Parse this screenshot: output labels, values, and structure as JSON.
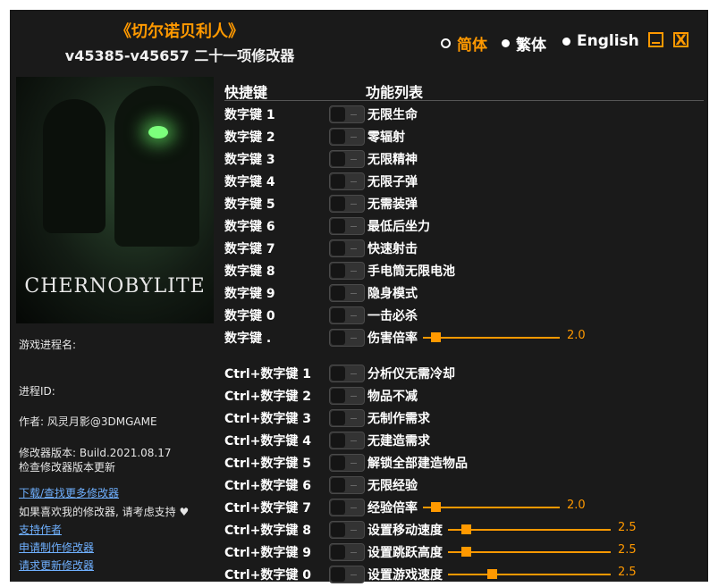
{
  "header": {
    "title": "《切尔诺贝利人》",
    "subtitle": "v45385-v45657 二十一项修改器"
  },
  "languages": [
    {
      "label": "简体",
      "selected": true
    },
    {
      "label": "繁体",
      "selected": false
    },
    {
      "label": "English",
      "selected": false
    }
  ],
  "window": {
    "minimize_icon": "minimize-icon",
    "close_glyph": "X"
  },
  "cover": {
    "logo_text": "CHERNOBYLITE"
  },
  "info": {
    "process_name": "游戏进程名:",
    "process_id": "进程ID:",
    "author": "作者: 风灵月影@3DMGAME",
    "version": "修改器版本: Build.2021.08.17",
    "check_update": "检查修改器版本更新",
    "download_more": "下载/查找更多修改器",
    "support_text": "如果喜欢我的修改器, 请考虑支持 ♥",
    "support_author": "支持作者",
    "request_trainer": "申请制作修改器",
    "request_update": "请求更新修改器"
  },
  "table": {
    "col_hotkey": "快捷键",
    "col_function": "功能列表",
    "rows": [
      {
        "key": "数字键 1",
        "label": "无限生命"
      },
      {
        "key": "数字键 2",
        "label": "零辐射"
      },
      {
        "key": "数字键 3",
        "label": "无限精神"
      },
      {
        "key": "数字键 4",
        "label": "无限子弹"
      },
      {
        "key": "数字键 5",
        "label": "无需装弹"
      },
      {
        "key": "数字键 6",
        "label": "最低后坐力"
      },
      {
        "key": "数字键 7",
        "label": "快速射击"
      },
      {
        "key": "数字键 8",
        "label": "手电筒无限电池"
      },
      {
        "key": "数字键 9",
        "label": "隐身模式"
      },
      {
        "key": "数字键 0",
        "label": "一击必杀"
      },
      {
        "key": "数字键 .",
        "label": "伤害倍率",
        "slider": {
          "value": "2.0",
          "fraction": 0.06
        }
      },
      {
        "key": "Ctrl+数字键 1",
        "label": "分析仪无需冷却"
      },
      {
        "key": "Ctrl+数字键 2",
        "label": "物品不减"
      },
      {
        "key": "Ctrl+数字键 3",
        "label": "无制作需求"
      },
      {
        "key": "Ctrl+数字键 4",
        "label": "无建造需求"
      },
      {
        "key": "Ctrl+数字键 5",
        "label": "解锁全部建造物品"
      },
      {
        "key": "Ctrl+数字键 6",
        "label": "无限经验"
      },
      {
        "key": "Ctrl+数字键 7",
        "label": "经验倍率",
        "slider": {
          "value": "2.0",
          "fraction": 0.06
        }
      },
      {
        "key": "Ctrl+数字键 8",
        "label": "设置移动速度",
        "slider": {
          "value": "2.5",
          "fraction": 0.09
        }
      },
      {
        "key": "Ctrl+数字键 9",
        "label": "设置跳跃高度",
        "slider": {
          "value": "2.5",
          "fraction": 0.09
        }
      },
      {
        "key": "Ctrl+数字键 0",
        "label": "设置游戏速度",
        "slider": {
          "value": "2.5",
          "fraction": 0.26
        }
      }
    ]
  },
  "colors": {
    "accent": "#ff9900",
    "background": "#1a1a1a",
    "link": "#6fb0ff"
  }
}
